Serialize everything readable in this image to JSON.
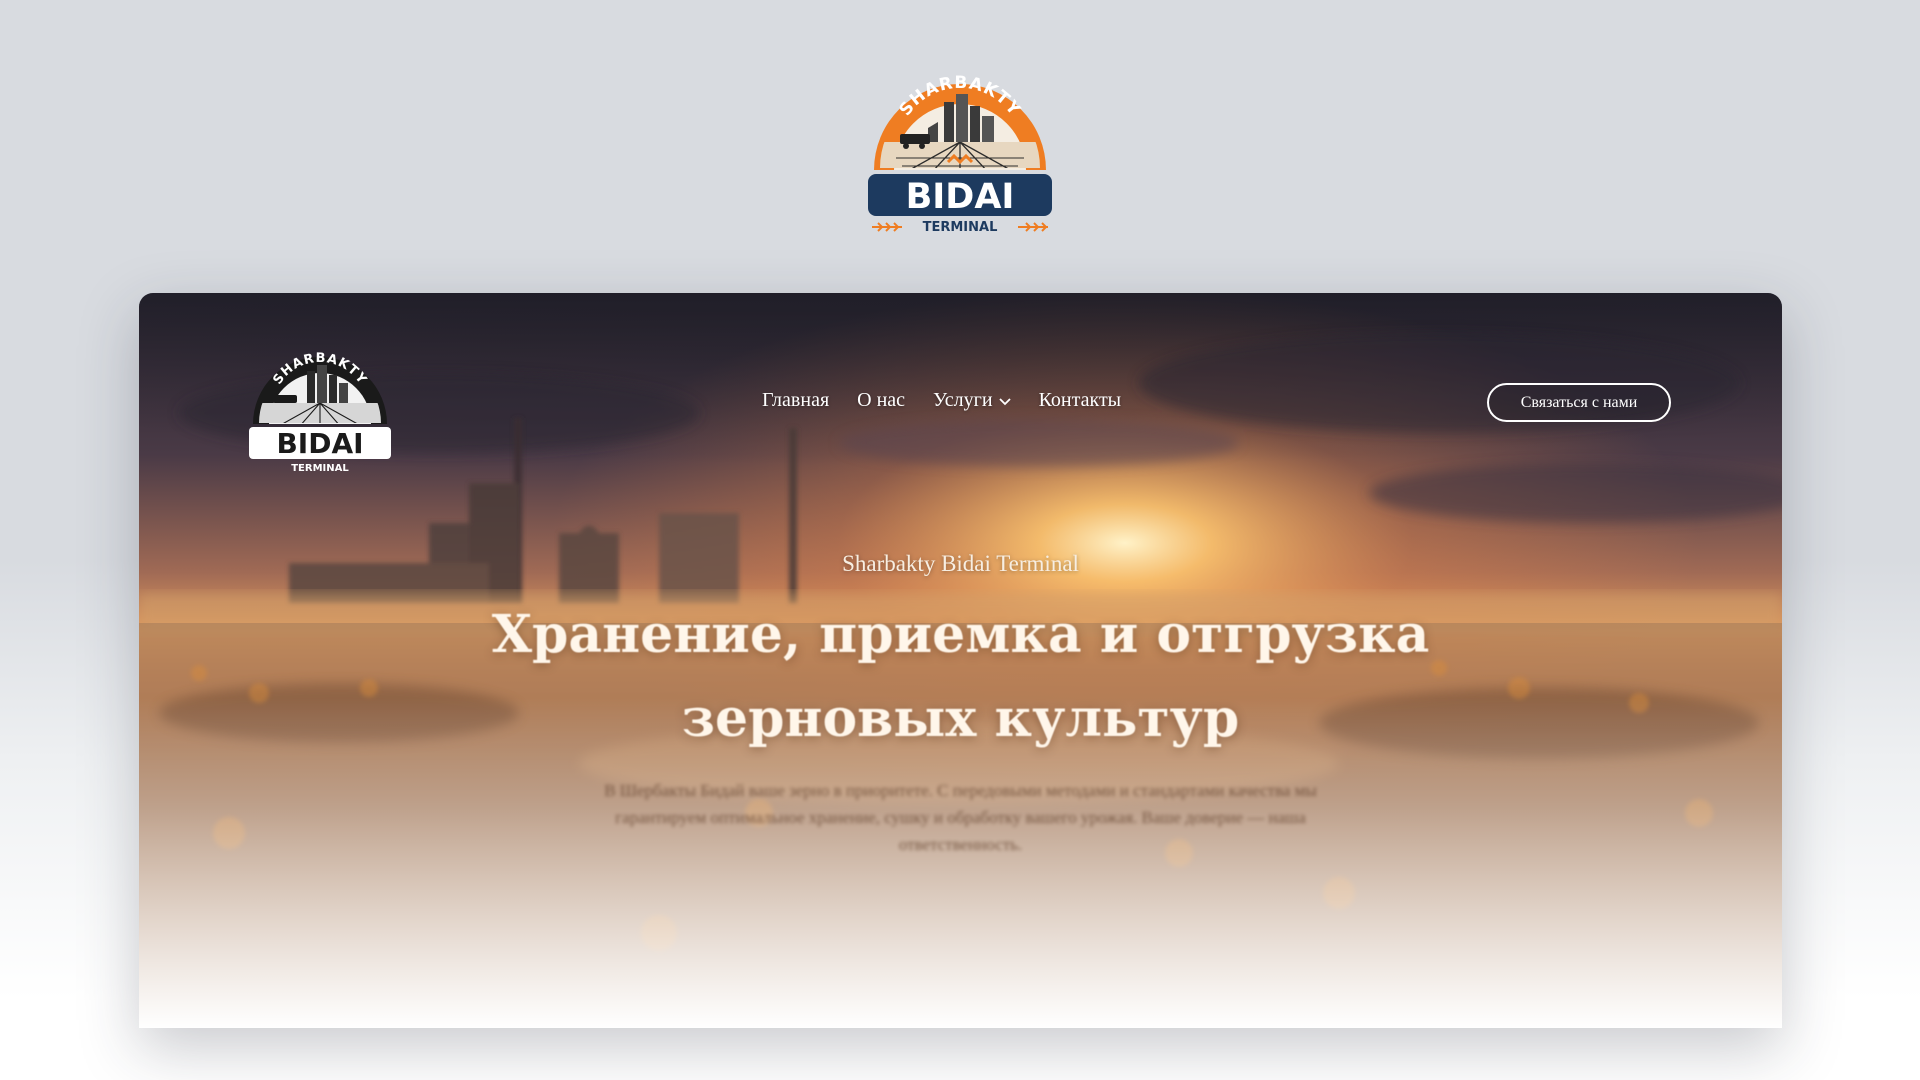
{
  "logo": {
    "arc_text": "SHARBAKTY",
    "main_text": "BIDAI",
    "sub_text": "TERMINAL"
  },
  "nav": {
    "items": [
      {
        "label": "Главная"
      },
      {
        "label": "О нас"
      },
      {
        "label": "Услуги",
        "has_dropdown": true
      },
      {
        "label": "Контакты"
      }
    ],
    "chevron_icon": "chevron-down-icon",
    "cta_label": "Связаться с нами"
  },
  "hero": {
    "subtitle": "Sharbakty Bidai Terminal",
    "title_line1": "Хранение, приемка и отгрузка",
    "title_line2": "зерновых культур",
    "description": "В Шербакты Бидай ваше зерно в приоритете. С передовыми методами и стандартами качества мы гарантируем оптимальное хранение, сушку и обработку вашего урожая. Ваше доверие — наша ответственность."
  },
  "colors": {
    "brand_orange": "#ef7d22",
    "brand_navy": "#1d3a5f",
    "page_bg": "#d8dbe0",
    "hero_sky_top": "#2a2836",
    "hero_sun": "#f6b25a"
  }
}
